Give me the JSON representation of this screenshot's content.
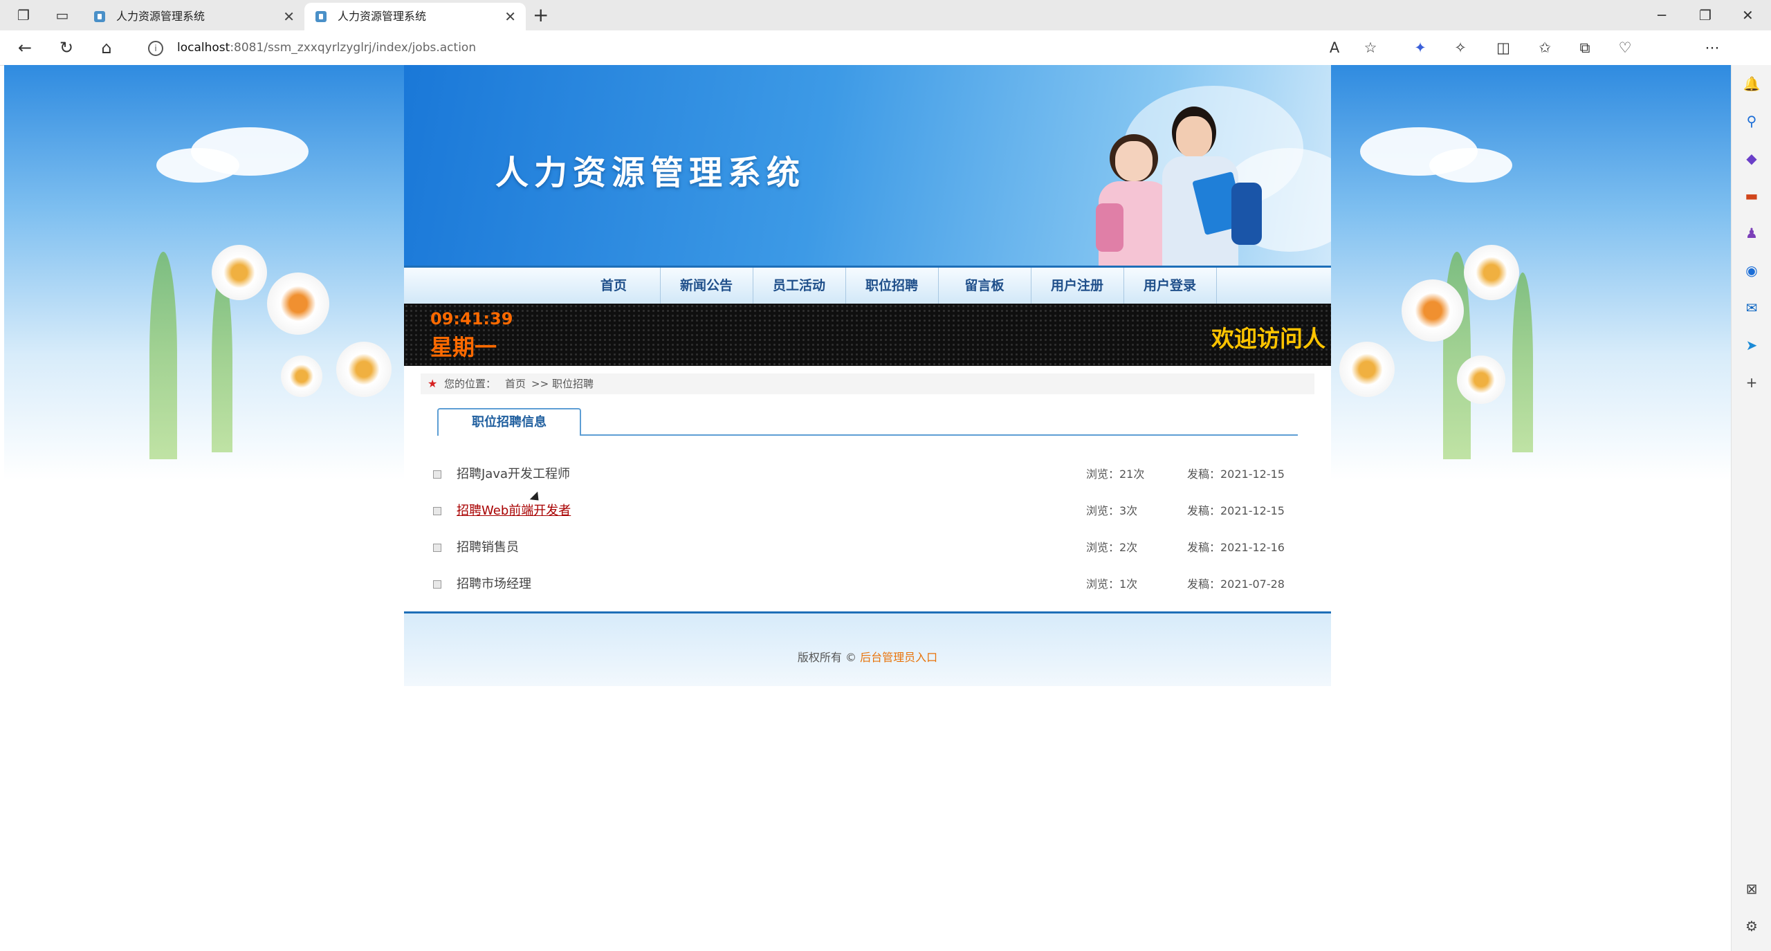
{
  "browser": {
    "tabs": [
      {
        "title": "人力资源管理系统",
        "active": false
      },
      {
        "title": "人力资源管理系统",
        "active": true
      }
    ],
    "url_host": "localhost",
    "url_path": ":8081/ssm_zxxqyrlzyglrj/index/jobs.action",
    "icons": {
      "workspaces": "workspaces-icon",
      "tab_actions": "tab-actions-icon",
      "back": "back-icon",
      "refresh": "refresh-icon",
      "home": "home-icon",
      "read_aloud": "read-aloud-icon",
      "favorite": "star-icon",
      "copilot": "copilot-icon",
      "extensions": "extensions-icon",
      "split": "split-screen-icon",
      "favorites": "favorites-icon",
      "collections": "collections-icon",
      "performance": "heart-pulse-icon",
      "more": "more-icon"
    }
  },
  "site": {
    "title": "人力资源管理系统",
    "menu": [
      "首页",
      "新闻公告",
      "员工活动",
      "职位招聘",
      "留言板",
      "用户注册",
      "用户登录"
    ],
    "ticker": {
      "time": "09:41:39",
      "weekday": "星期一",
      "welcome": "欢迎访问人"
    },
    "breadcrumb": {
      "label": "您的位置：",
      "home": "首页",
      "separator": ">>",
      "current": "职位招聘"
    },
    "section_tab": "职位招聘信息",
    "jobs": [
      {
        "name": "招聘Java开发工程师",
        "views": "浏览：21次",
        "date": "发稿：2021-12-15"
      },
      {
        "name": "招聘Web前端开发者",
        "views": "浏览：3次",
        "date": "发稿：2021-12-15"
      },
      {
        "name": "招聘销售员",
        "views": "浏览：2次",
        "date": "发稿：2021-12-16"
      },
      {
        "name": "招聘市场经理",
        "views": "浏览：1次",
        "date": "发稿：2021-07-28"
      }
    ],
    "footer": {
      "copyright": "版权所有 © ",
      "admin_link": "后台管理员入口"
    }
  },
  "colors": {
    "banner_blue": "#1a78d8",
    "menu_text": "#1f4f8a",
    "ticker_orange": "#ff6a00",
    "ticker_yellow": "#ffc400",
    "admin_link": "#e8730a",
    "hover_link": "#a80000"
  }
}
